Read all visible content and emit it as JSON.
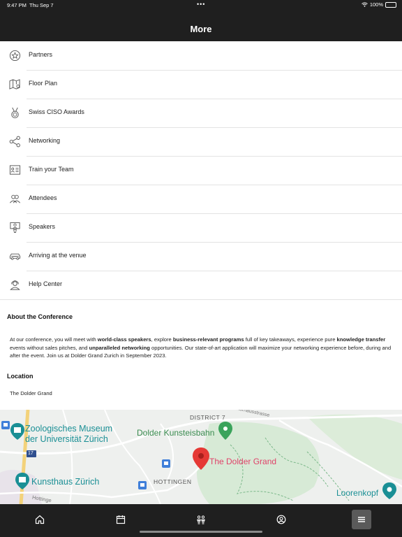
{
  "status": {
    "time": "9:47 PM",
    "date": "Thu Sep 7",
    "battery": "100%"
  },
  "header": {
    "title": "More"
  },
  "menu": [
    {
      "label": "Partners",
      "icon": "star-badge-icon"
    },
    {
      "label": "Floor Plan",
      "icon": "map-pin-icon"
    },
    {
      "label": "Swiss CISO Awards",
      "icon": "medal-icon"
    },
    {
      "label": "Networking",
      "icon": "share-network-icon"
    },
    {
      "label": "Train your Team",
      "icon": "training-icon"
    },
    {
      "label": "Attendees",
      "icon": "people-icon"
    },
    {
      "label": "Speakers",
      "icon": "speaker-podium-icon"
    },
    {
      "label": "Arriving at the venue",
      "icon": "car-icon"
    },
    {
      "label": "Help Center",
      "icon": "help-agent-icon"
    }
  ],
  "about": {
    "heading": "About the Conference",
    "p1": "At our conference, you will meet with ",
    "b1": "world-class speakers",
    "p2": ", explore ",
    "b2": "business-relevant programs",
    "p3": " full of key takeaways, experience pure ",
    "b3": "knowledge transfer",
    "p4": " events without sales pitches, and ",
    "b4": "unparalleled networking",
    "p5": " opportunities. Our state-of-art application will maximize your networking experience before, during and after the event. Join us at Dolder Grand Zurich in September 2023."
  },
  "location": {
    "heading": "Location",
    "name": "The Dolder Grand"
  },
  "map": {
    "labels": {
      "zoo1": "Zoologisches Museum",
      "zoo2": "der Universität Zürich",
      "district": "DISTRICT 7",
      "bahn": "Dolder Kunsteisbahn",
      "venue": "The Dolder Grand",
      "kunsthaus": "Kunsthaus Zürich",
      "hottingen": "HOTTINGEN",
      "lorenkopf": "Loorenkopf",
      "route": "17",
      "street": "Hottinge",
      "street2": "Kurhausstrasse"
    },
    "colors": {
      "pin": "#e53935",
      "venue_text": "#e0436a",
      "poi_teal": "#1a8f95",
      "poi_green": "#3aa35b"
    }
  },
  "tabs": [
    {
      "name": "home-icon"
    },
    {
      "name": "calendar-icon"
    },
    {
      "name": "attendees-icon"
    },
    {
      "name": "profile-icon"
    },
    {
      "name": "menu-icon",
      "active": true
    }
  ]
}
